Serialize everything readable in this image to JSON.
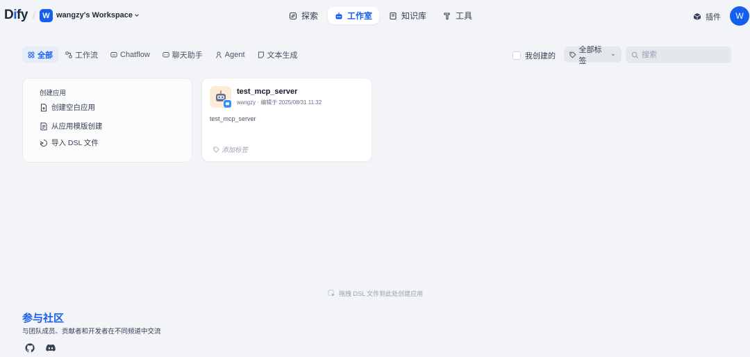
{
  "header": {
    "logo_main": "D",
    "logo_i": "i",
    "logo_rest": "fy",
    "workspace_badge": "W",
    "workspace_name": "wangzy's Workspace",
    "nav": [
      {
        "label": "探索"
      },
      {
        "label": "工作室"
      },
      {
        "label": "知识库"
      },
      {
        "label": "工具"
      }
    ],
    "plugin_label": "插件",
    "avatar_initial": "W"
  },
  "filters": {
    "tabs": [
      {
        "label": "全部"
      },
      {
        "label": "工作流"
      },
      {
        "label": "Chatflow"
      },
      {
        "label": "聊天助手"
      },
      {
        "label": "Agent"
      },
      {
        "label": "文本生成"
      }
    ],
    "mine_label": "我创建的",
    "tag_filter_label": "全部标签",
    "search_placeholder": "搜索"
  },
  "create": {
    "title": "创建应用",
    "items": [
      {
        "label": "创建空白应用"
      },
      {
        "label": "从应用模版创建"
      },
      {
        "label": "导入 DSL 文件"
      }
    ]
  },
  "apps": [
    {
      "name": "test_mcp_server",
      "meta": "wangzy · 编辑于 2025/08/31 11:32",
      "description": "test_mcp_server",
      "tag_placeholder": "添加标签"
    }
  ],
  "drop_hint": "拖拽 DSL 文件到此处创建应用",
  "community": {
    "title": "参与社区",
    "subtitle": "与团队成员、贡献者和开发者在不同频道中交流"
  },
  "colors": {
    "accent": "#155eef",
    "background": "#f2f4f7"
  }
}
